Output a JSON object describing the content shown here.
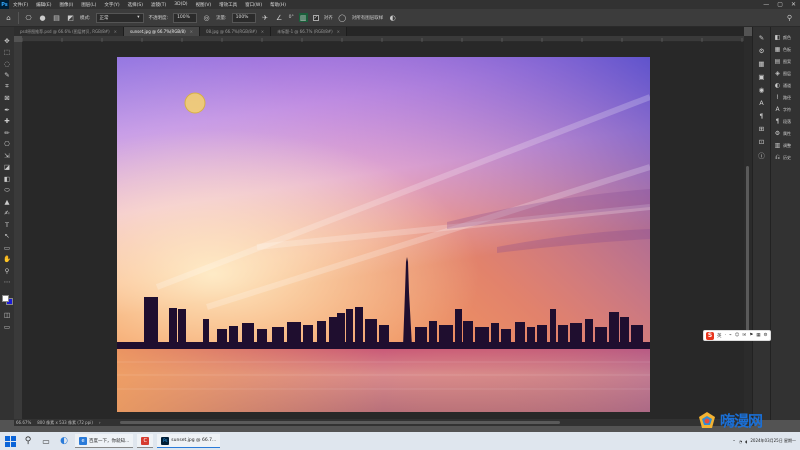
{
  "app": {
    "logo": "Ps"
  },
  "menu": [
    "文件(F)",
    "编辑(E)",
    "图像(I)",
    "图层(L)",
    "文字(Y)",
    "选择(S)",
    "滤镜(T)",
    "3D(D)",
    "视图(V)",
    "增效工具",
    "窗口(W)",
    "帮助(H)"
  ],
  "window_controls": [
    "—",
    "▢",
    "✕"
  ],
  "options": {
    "mode_label": "模式:",
    "mode_value": "正常",
    "opacity_label": "不透明度:",
    "opacity_value": "100%",
    "flow_label": "流量:",
    "flow_value": "100%",
    "angle_value": "0°",
    "align_label": "对齐",
    "sample_all_label": "对所有图层取样"
  },
  "tabs": [
    {
      "label": "psd原图推荐.psd @ 66.6% (图层拷贝, RGB/8#)",
      "active": false
    },
    {
      "label": "sunset.jpg @ 66.7%(RGB/8)",
      "active": true
    },
    {
      "label": "08.jpg @ 66.7%(RGB/8#)",
      "active": false
    },
    {
      "label": "未标题-1 @ 66.7% (RGB/8#)",
      "active": false
    }
  ],
  "tools": [
    "✥",
    "⬚",
    "◌",
    "✎",
    "⌗",
    "⊠",
    "✒",
    "✚",
    "✏",
    "⎔",
    "⇲",
    "◪",
    "◧",
    "⬭",
    "▲",
    "✍",
    "T",
    "↖",
    "▭",
    "✋",
    "⚲",
    "⋯"
  ],
  "swatches": {
    "foreground": "#ffffff",
    "background": "#1b1bd6"
  },
  "panels": {
    "strip1": [
      "✎",
      "⚙",
      "▦",
      "▣",
      "◉",
      "A",
      "¶",
      "⊞",
      "⊡",
      "ⓘ"
    ],
    "strip2": [
      {
        "icon": "◧",
        "label": "颜色"
      },
      {
        "icon": "▦",
        "label": "色板"
      },
      {
        "icon": "▤",
        "label": "图案"
      },
      {
        "icon": "◈",
        "label": "图层"
      },
      {
        "icon": "◐",
        "label": "通道"
      },
      {
        "icon": "⌇",
        "label": "路径"
      },
      {
        "icon": "A",
        "label": "字符"
      },
      {
        "icon": "¶",
        "label": "段落"
      },
      {
        "icon": "⚙",
        "label": "属性"
      },
      {
        "icon": "▥",
        "label": "调整"
      },
      {
        "icon": "⎌",
        "label": "历史"
      }
    ]
  },
  "status": {
    "zoom": "66.67%",
    "doc_info": "800 像素 x 533 像素 (72 ppi)"
  },
  "ime": {
    "logo": "S",
    "lang": "英",
    "icons": [
      "·",
      "⌁",
      "☺",
      "✉",
      "⚑",
      "▦",
      "⚙"
    ]
  },
  "taskbar": {
    "search_icon": "⚲",
    "apps": [
      {
        "label": "百度一下，你就知...",
        "color": "#2a7bd9",
        "icon": "e"
      },
      {
        "label": "",
        "color": "#d63b2f",
        "icon": "C"
      },
      {
        "label": "sunset.jpg @ 66.7...",
        "color": "#001e36",
        "icon": "Ps"
      }
    ],
    "date": "2024年03月25日 星期一",
    "time": ""
  },
  "watermark": {
    "text": "嗨漫网"
  }
}
